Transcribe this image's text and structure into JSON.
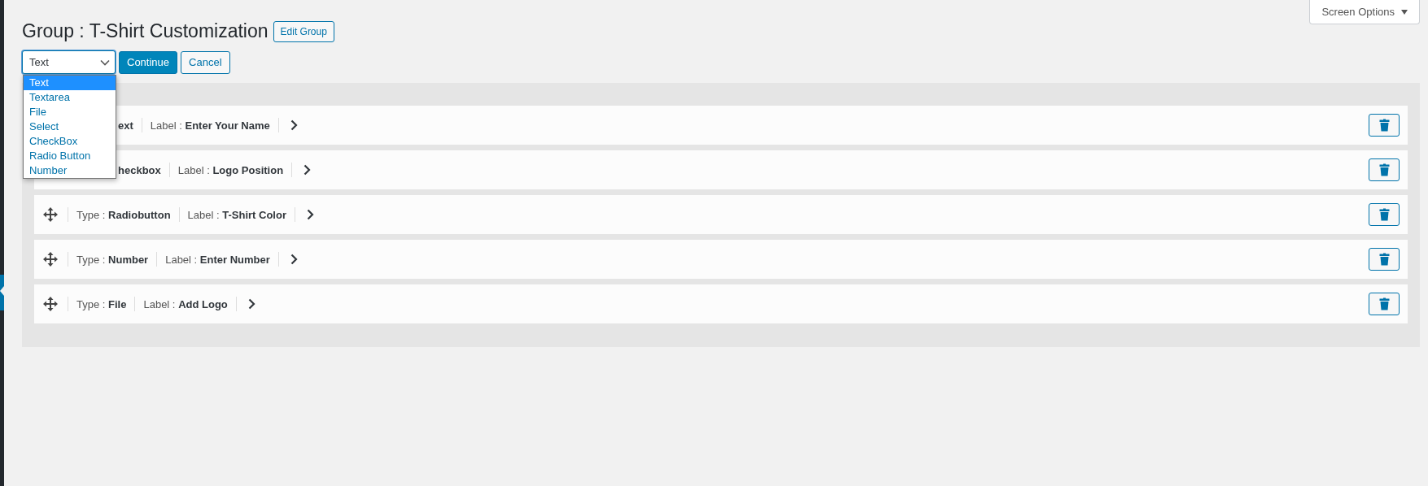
{
  "title": "Group : T-Shirt Customization",
  "edit_button": "Edit Group",
  "screen_options": "Screen Options",
  "field_type_select": {
    "value": "Text",
    "expanded": true,
    "options": [
      {
        "label": "Text",
        "selected": true
      },
      {
        "label": "Textarea",
        "selected": false
      },
      {
        "label": "File",
        "selected": false
      },
      {
        "label": "Select",
        "selected": false
      },
      {
        "label": "CheckBox",
        "selected": false
      },
      {
        "label": "Radio Button",
        "selected": false
      },
      {
        "label": "Number",
        "selected": false
      }
    ]
  },
  "continue_button": "Continue",
  "cancel_button": "Cancel",
  "fields": [
    {
      "type": "ext",
      "label_prefix": "Label :",
      "label": "Enter Your Name"
    },
    {
      "type": "heckbox",
      "label_prefix": "Label :",
      "label": "Logo Position"
    },
    {
      "type_prefix": "Type :",
      "type": "Radiobutton",
      "label_prefix": "Label :",
      "label": "T-Shirt Color"
    },
    {
      "type_prefix": "Type :",
      "type": "Number",
      "label_prefix": "Label :",
      "label": "Enter Number"
    },
    {
      "type_prefix": "Type :",
      "type": "File",
      "label_prefix": "Label :",
      "label": "Add Logo"
    }
  ]
}
